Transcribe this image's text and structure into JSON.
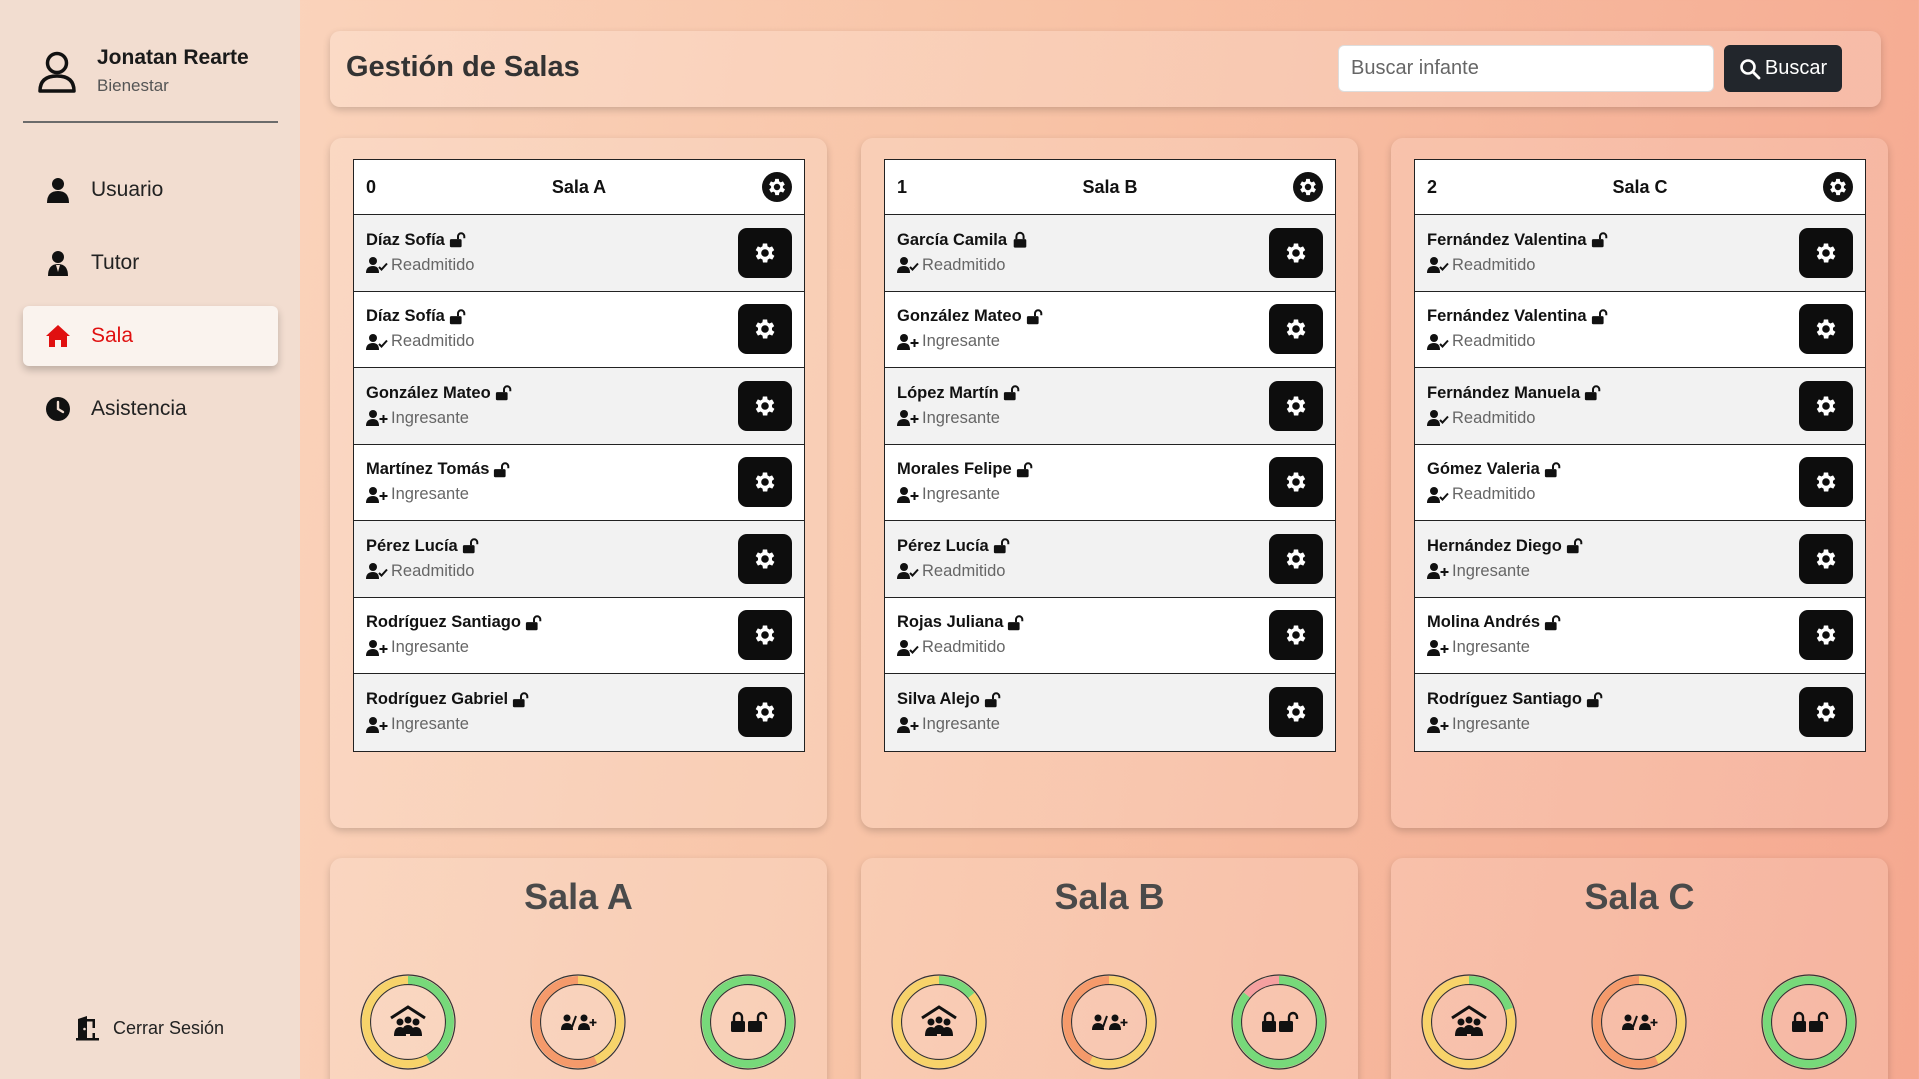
{
  "user": {
    "name": "Jonatan Rearte",
    "role": "Bienestar"
  },
  "nav": [
    {
      "label": "Usuario",
      "icon": "user-icon",
      "active": false
    },
    {
      "label": "Tutor",
      "icon": "tutor-icon",
      "active": false
    },
    {
      "label": "Sala",
      "icon": "home-icon",
      "active": true
    },
    {
      "label": "Asistencia",
      "icon": "clock-icon",
      "active": false
    }
  ],
  "logout_label": "Cerrar Sesión",
  "header": {
    "title": "Gestión de Salas",
    "search_placeholder": "Buscar infante",
    "search_button": "Buscar"
  },
  "colors": {
    "active": "#e01010",
    "dark": "#0d0d0d",
    "ring_green": "#77d97a",
    "ring_yellow": "#f7d36a",
    "ring_orange": "#f59a6b",
    "ring_pink": "#f5a0a0"
  },
  "rooms": [
    {
      "number": "0",
      "name": "Sala A",
      "children": [
        {
          "name": "Díaz Sofía",
          "lock": "open",
          "status": "Readmitido"
        },
        {
          "name": "Díaz Sofía",
          "lock": "open",
          "status": "Readmitido"
        },
        {
          "name": "González Mateo",
          "lock": "open",
          "status": "Ingresante"
        },
        {
          "name": "Martínez Tomás",
          "lock": "open",
          "status": "Ingresante"
        },
        {
          "name": "Pérez Lucía",
          "lock": "open",
          "status": "Readmitido"
        },
        {
          "name": "Rodríguez Santiago",
          "lock": "open",
          "status": "Ingresante"
        },
        {
          "name": "Rodríguez Gabriel",
          "lock": "open",
          "status": "Ingresante"
        }
      ]
    },
    {
      "number": "1",
      "name": "Sala B",
      "children": [
        {
          "name": "García Camila",
          "lock": "closed",
          "status": "Readmitido"
        },
        {
          "name": "González Mateo",
          "lock": "open",
          "status": "Ingresante"
        },
        {
          "name": "López Martín",
          "lock": "open",
          "status": "Ingresante"
        },
        {
          "name": "Morales Felipe",
          "lock": "open",
          "status": "Ingresante"
        },
        {
          "name": "Pérez Lucía",
          "lock": "open",
          "status": "Readmitido"
        },
        {
          "name": "Rojas Juliana",
          "lock": "open",
          "status": "Readmitido"
        },
        {
          "name": "Silva Alejo",
          "lock": "open",
          "status": "Ingresante"
        }
      ]
    },
    {
      "number": "2",
      "name": "Sala C",
      "children": [
        {
          "name": "Fernández Valentina",
          "lock": "open",
          "status": "Readmitido"
        },
        {
          "name": "Fernández Valentina",
          "lock": "open",
          "status": "Readmitido"
        },
        {
          "name": "Fernández Manuela",
          "lock": "open",
          "status": "Readmitido"
        },
        {
          "name": "Gómez Valeria",
          "lock": "open",
          "status": "Readmitido"
        },
        {
          "name": "Hernández Diego",
          "lock": "open",
          "status": "Ingresante"
        },
        {
          "name": "Molina Andrés",
          "lock": "open",
          "status": "Ingresante"
        },
        {
          "name": "Rodríguez Santiago",
          "lock": "open",
          "status": "Ingresante"
        }
      ]
    }
  ],
  "stats": [
    {
      "title": "Sala A",
      "donuts": [
        {
          "icon": "classroom-icon",
          "segments": [
            {
              "color": "#77d97a",
              "fraction": 0.42
            },
            {
              "color": "#f7d36a",
              "fraction": 0.58
            }
          ]
        },
        {
          "icon": "students-ratio-icon",
          "segments": [
            {
              "color": "#f7d36a",
              "fraction": 0.43
            },
            {
              "color": "#f59a6b",
              "fraction": 0.57
            }
          ]
        },
        {
          "icon": "locks-icon",
          "segments": [
            {
              "color": "#77d97a",
              "fraction": 1.0
            }
          ]
        }
      ]
    },
    {
      "title": "Sala B",
      "donuts": [
        {
          "icon": "classroom-icon",
          "segments": [
            {
              "color": "#77d97a",
              "fraction": 0.14
            },
            {
              "color": "#f7d36a",
              "fraction": 0.86
            }
          ]
        },
        {
          "icon": "students-ratio-icon",
          "segments": [
            {
              "color": "#f7d36a",
              "fraction": 0.57
            },
            {
              "color": "#f59a6b",
              "fraction": 0.43
            }
          ]
        },
        {
          "icon": "locks-icon",
          "segments": [
            {
              "color": "#77d97a",
              "fraction": 0.86
            },
            {
              "color": "#f5a0a0",
              "fraction": 0.14
            }
          ]
        }
      ]
    },
    {
      "title": "Sala C",
      "donuts": [
        {
          "icon": "classroom-icon",
          "segments": [
            {
              "color": "#77d97a",
              "fraction": 0.2
            },
            {
              "color": "#f7d36a",
              "fraction": 0.8
            }
          ]
        },
        {
          "icon": "students-ratio-icon",
          "segments": [
            {
              "color": "#f7d36a",
              "fraction": 0.43
            },
            {
              "color": "#f59a6b",
              "fraction": 0.57
            }
          ]
        },
        {
          "icon": "locks-icon",
          "segments": [
            {
              "color": "#77d97a",
              "fraction": 1.0
            }
          ]
        }
      ]
    }
  ]
}
